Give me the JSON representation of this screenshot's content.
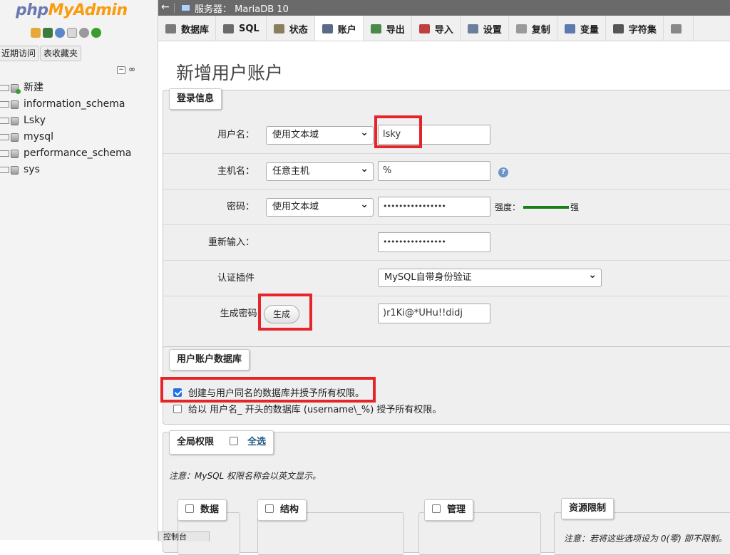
{
  "nav": {
    "logo_a": "php",
    "logo_b": "MyAdmin",
    "tab_recent": "近期访问",
    "tab_favorites": "表收藏夹",
    "tree": [
      {
        "label": "新建",
        "kind": "new"
      },
      {
        "label": "information_schema",
        "kind": "db"
      },
      {
        "label": "Lsky",
        "kind": "db"
      },
      {
        "label": "mysql",
        "kind": "db"
      },
      {
        "label": "performance_schema",
        "kind": "db"
      },
      {
        "label": "sys",
        "kind": "db"
      }
    ]
  },
  "topbar": {
    "back": "←",
    "server": "服务器： MariaDB 10"
  },
  "tabs": [
    {
      "label": "数据库",
      "icon": "database-icon",
      "color": "#7a7a7a"
    },
    {
      "label": "SQL",
      "icon": "sql-icon",
      "color": "#6b6b6b"
    },
    {
      "label": "状态",
      "icon": "status-icon",
      "color": "#8a7f5a"
    },
    {
      "label": "账户",
      "icon": "users-icon",
      "color": "#5a6b8a"
    },
    {
      "label": "导出",
      "icon": "export-icon",
      "color": "#4a8a4a"
    },
    {
      "label": "导入",
      "icon": "import-icon",
      "color": "#c04040"
    },
    {
      "label": "设置",
      "icon": "wrench-icon",
      "color": "#6a7fa0"
    },
    {
      "label": "复制",
      "icon": "replication-icon",
      "color": "#9a9a9a"
    },
    {
      "label": "变量",
      "icon": "variables-icon",
      "color": "#5a7ab0"
    },
    {
      "label": "字符集",
      "icon": "charset-icon",
      "color": "#555555"
    },
    {
      "label": "",
      "icon": "engine-icon",
      "color": "#888888"
    }
  ],
  "page_title": "新增用户账户",
  "login": {
    "legend": "登录信息",
    "username_label": "用户名：",
    "username_select": "使用文本域",
    "username_value": "lsky",
    "host_label": "主机名：",
    "host_select": "任意主机",
    "host_value": "%",
    "password_label": "密码：",
    "password_select": "使用文本域",
    "password_value": "••••••••••••••••",
    "strength_label": "强度：",
    "strength_value": "强",
    "strength_color": "#1a7f1a",
    "retype_label": "重新输入：",
    "retype_value": "••••••••••••••••",
    "auth_label": "认证插件",
    "auth_select": "MySQL自带身份验证",
    "generate_label": "生成密码:",
    "generate_button": "生成",
    "generated_value": ")r1Ki@*UHu!!didj"
  },
  "userdb": {
    "legend": "用户账户数据库",
    "opt1": "创建与用户同名的数据库并授予所有权限。",
    "opt1_checked": true,
    "opt2": "给以 用户名_ 开头的数据库 (username\\_%) 授予所有权限。",
    "opt2_checked": false
  },
  "global": {
    "legend": "全局权限",
    "select_all": "全选",
    "note": "注意：MySQL 权限名称会以英文显示。",
    "groups": [
      "数据",
      "结构",
      "管理"
    ],
    "resource_legend": "资源限制",
    "resource_note": "注意：若将这些选项设为 0(零) 即不限制。"
  },
  "console": "控制台",
  "highlight_color": "#e5252a"
}
